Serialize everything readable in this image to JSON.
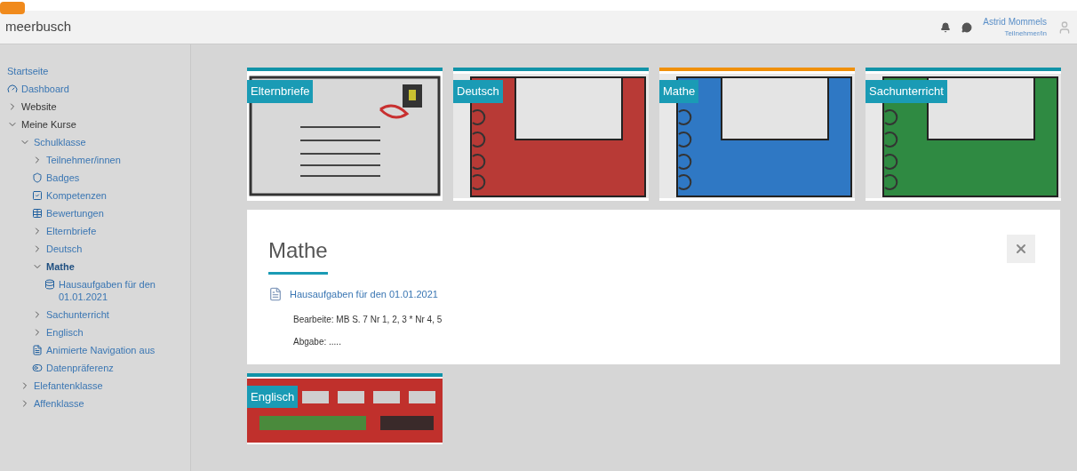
{
  "header": {
    "site_name": "meerbusch",
    "user_name": "Astrid Mommels",
    "user_role": "Teilnehmer/in"
  },
  "sidebar": {
    "items": [
      {
        "label": "Startseite",
        "kind": "text",
        "selected": false
      },
      {
        "label": "Dashboard",
        "kind": "link",
        "selected": false
      },
      {
        "label": "Website",
        "kind": "folder",
        "expanded": false,
        "selected": false
      },
      {
        "label": "Meine Kurse",
        "kind": "folder",
        "expanded": true,
        "selected": false,
        "children": [
          {
            "label": "Schulklasse",
            "kind": "folder",
            "expanded": true,
            "selected": false,
            "children": [
              {
                "label": "Teilnehmer/innen",
                "kind": "folder",
                "expanded": false,
                "selected": false
              },
              {
                "label": "Badges",
                "kind": "link",
                "selected": false
              },
              {
                "label": "Kompetenzen",
                "kind": "link",
                "selected": false
              },
              {
                "label": "Bewertungen",
                "kind": "link",
                "selected": false
              },
              {
                "label": "Elternbriefe",
                "kind": "folder",
                "expanded": false,
                "selected": false
              },
              {
                "label": "Deutsch",
                "kind": "folder",
                "expanded": false,
                "selected": false
              },
              {
                "label": "Mathe",
                "kind": "folder",
                "expanded": true,
                "selected": true,
                "children": [
                  {
                    "label": "Hausaufgaben für den 01.01.2021",
                    "kind": "link",
                    "selected": false
                  }
                ]
              },
              {
                "label": "Sachunterricht",
                "kind": "folder",
                "expanded": false,
                "selected": false
              },
              {
                "label": "Englisch",
                "kind": "folder",
                "expanded": false,
                "selected": false
              },
              {
                "label": "Animierte Navigation aus",
                "kind": "link",
                "selected": false
              },
              {
                "label": "Datenpräferenz",
                "kind": "link",
                "selected": false
              }
            ]
          },
          {
            "label": "Elefantenklasse",
            "kind": "folder",
            "expanded": false,
            "selected": false
          },
          {
            "label": "Affenklasse",
            "kind": "folder",
            "expanded": false,
            "selected": false
          }
        ]
      }
    ]
  },
  "tiles": [
    {
      "label": "Elternbriefe",
      "kind": "envelope",
      "selected": false
    },
    {
      "label": "Deutsch",
      "kind": "notebook",
      "color": "#b83a36",
      "selected": false
    },
    {
      "label": "Mathe",
      "kind": "notebook",
      "color": "#2f78c4",
      "selected": true
    },
    {
      "label": "Sachunterricht",
      "kind": "notebook",
      "color": "#2f8a42",
      "selected": false
    }
  ],
  "panel": {
    "title": "Mathe",
    "activity": "Hausaufgaben für den 01.01.2021",
    "lines": [
      "Bearbeite: MB S. 7 Nr 1, 2, 3 * Nr 4, 5",
      "Abgabe: ....."
    ]
  },
  "more_tiles": [
    {
      "label": "Englisch",
      "kind": "bus",
      "selected": false
    }
  ]
}
